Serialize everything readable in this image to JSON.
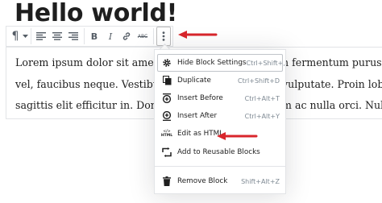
{
  "heading": "Hello world!",
  "paragraph_lines": [
    "Lorem ipsum dolor sit amet, co",
    "vel, faucibus neque. Vestibulum",
    "sagittis elit efficitur in. Donec pu",
    "n fermentum purus co",
    "vulputate. Proin lobort",
    "m ac nulla orci. Nulla"
  ],
  "toolbar": {
    "buttons": [
      "paragraph-icon",
      "chevron-down-icon",
      "align-left-icon",
      "align-center-icon",
      "align-right-icon",
      "bold-icon",
      "italic-icon",
      "link-icon",
      "strikethrough-icon",
      "more-options-icon"
    ],
    "bold": "B",
    "italic": "I",
    "strike": "ABC",
    "paragraph": "¶"
  },
  "menu": {
    "items": [
      {
        "label": "Hide Block Settings",
        "shortcut": "Ctrl+Shift+,",
        "icon": "gear-icon"
      },
      {
        "label": "Duplicate",
        "shortcut": "Ctrl+Shift+D",
        "icon": "duplicate-icon"
      },
      {
        "label": "Insert Before",
        "shortcut": "Ctrl+Alt+T",
        "icon": "insert-before-icon"
      },
      {
        "label": "Insert After",
        "shortcut": "Ctrl+Alt+Y",
        "icon": "insert-after-icon"
      },
      {
        "label": "Edit as HTML",
        "shortcut": "",
        "icon": "html-icon",
        "icon_text": "HTML"
      },
      {
        "label": "Add to Reusable Blocks",
        "shortcut": "",
        "icon": "reusable-blocks-icon"
      },
      {
        "label": "Remove Block",
        "shortcut": "Shift+Alt+Z",
        "icon": "trash-icon"
      }
    ]
  },
  "colors": {
    "arrow": "#d9262c",
    "text": "#1e1e1e",
    "muted": "#7e8993",
    "border": "#e2e4e7"
  }
}
